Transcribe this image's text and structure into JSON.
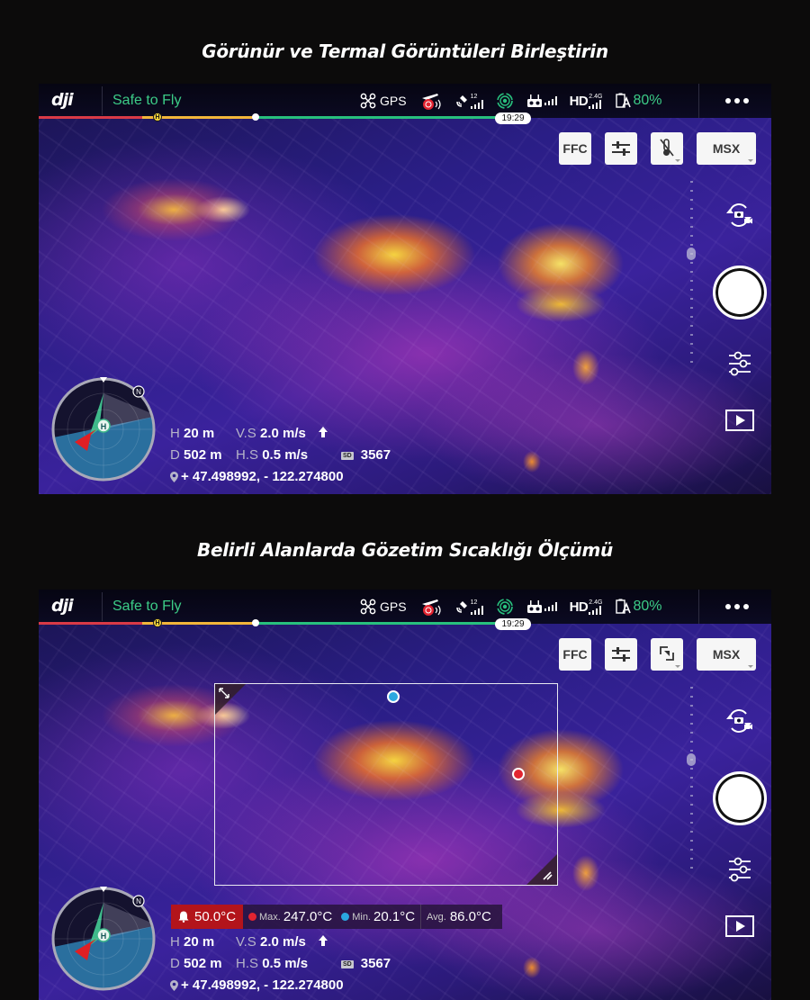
{
  "sections": [
    {
      "title": "Görünür ve Termal Görüntüleri Birleştirin",
      "status_bar": {
        "logo": "dji",
        "flight_status": "Safe to Fly",
        "gps_label": "GPS",
        "satellite_count": "12",
        "hd_band": "2.4G",
        "hd_label": "HD",
        "battery": "80%",
        "flight_time": "19:29",
        "more_icon": "more-dots-icon"
      },
      "tools": {
        "ffc_label": "FFC",
        "adjust_icon": "sliders-icon",
        "third_icon": "thermometer-off-icon",
        "palette_label": "MSX"
      },
      "telemetry": {
        "h_label": "H",
        "h_value": "20 m",
        "vs_label": "V.S",
        "vs_value": "2.0 m/s",
        "d_label": "D",
        "d_value": "502 m",
        "hs_label": "H.S",
        "hs_value": "0.5 m/s",
        "sd_label": "SD",
        "sd_value": "3567",
        "coords": "+ 47.498992, - 122.274800"
      },
      "compass": {
        "north": "N",
        "home": "H"
      }
    },
    {
      "title": "Belirli Alanlarda Gözetim Sıcaklığı Ölçümü",
      "status_bar": {
        "logo": "dji",
        "flight_status": "Safe to Fly",
        "gps_label": "GPS",
        "satellite_count": "12",
        "hd_band": "2.4G",
        "hd_label": "HD",
        "battery": "80%",
        "flight_time": "19:29",
        "more_icon": "more-dots-icon"
      },
      "tools": {
        "ffc_label": "FFC",
        "adjust_icon": "sliders-icon",
        "third_icon": "area-measure-icon",
        "palette_label": "MSX"
      },
      "temperature": {
        "alarm": "50.0°C",
        "max_label": "Max.",
        "max_value": "247.0°C",
        "min_label": "Min.",
        "min_value": "20.1°C",
        "avg_label": "Avg.",
        "avg_value": "86.0°C",
        "max_color": "#e22430",
        "min_color": "#2aa8e0",
        "alarm_color": "#b3141b"
      },
      "telemetry": {
        "h_label": "H",
        "h_value": "20 m",
        "vs_label": "V.S",
        "vs_value": "2.0 m/s",
        "d_label": "D",
        "d_value": "502 m",
        "hs_label": "H.S",
        "hs_value": "0.5 m/s",
        "sd_label": "SD",
        "sd_value": "3567",
        "coords": "+ 47.498992, - 122.274800"
      },
      "compass": {
        "north": "N",
        "home": "H"
      }
    }
  ],
  "colors": {
    "safe_green": "#3ccc87",
    "route_red": "#d93a46",
    "route_yellow": "#f2b63a",
    "route_green": "#28c07d"
  }
}
